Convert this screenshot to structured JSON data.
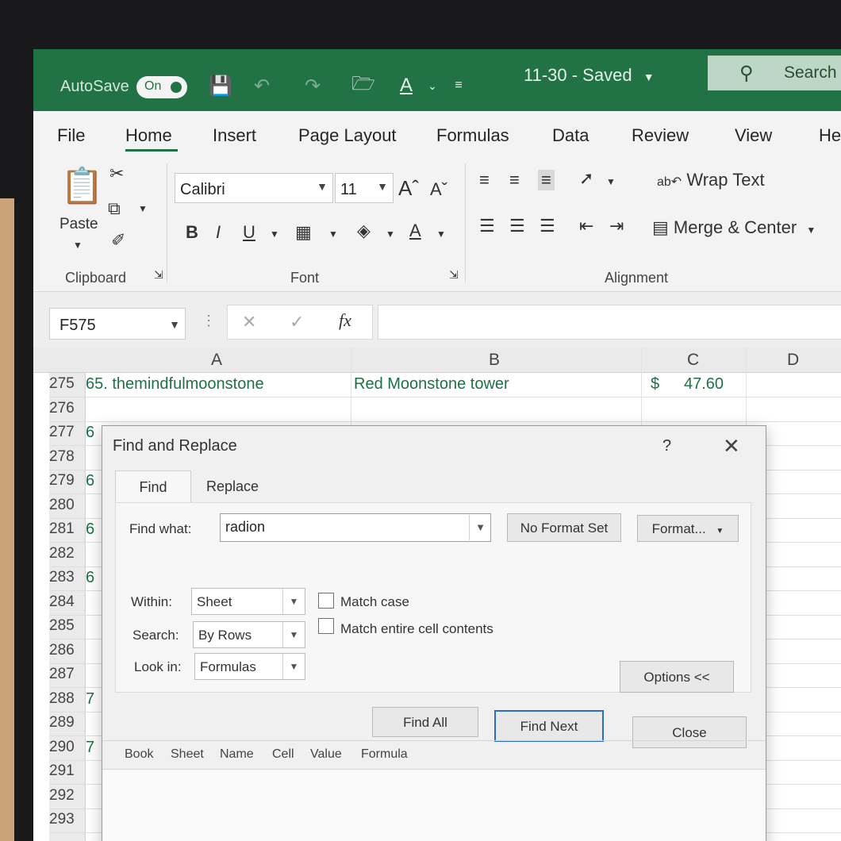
{
  "titlebar": {
    "autosave_label": "AutoSave",
    "autosave_state": "On",
    "doc_title": "11-30 - Saved",
    "search_placeholder": "Search"
  },
  "ribbon_tabs": [
    "File",
    "Home",
    "Insert",
    "Page Layout",
    "Formulas",
    "Data",
    "Review",
    "View",
    "He"
  ],
  "ribbon": {
    "clipboard": {
      "paste_label": "Paste",
      "group_label": "Clipboard"
    },
    "font": {
      "font_name": "Calibri",
      "font_size": "11",
      "group_label": "Font",
      "bold": "B",
      "italic": "I",
      "underline": "U"
    },
    "alignment": {
      "wrap_text": "Wrap Text",
      "merge_center": "Merge & Center",
      "group_label": "Alignment"
    }
  },
  "formula_bar": {
    "name_box": "F575",
    "fx_label": "fx",
    "formula": ""
  },
  "grid": {
    "columns": [
      "A",
      "B",
      "C",
      "D"
    ],
    "rows": [
      {
        "num": "275",
        "a": "65. themindfulmoonstone",
        "b": "Red Moonstone tower",
        "c_currency": "$",
        "c_value": "47.60"
      },
      {
        "num": "276"
      },
      {
        "num": "277",
        "a": "6"
      },
      {
        "num": "278"
      },
      {
        "num": "279",
        "a": "6"
      },
      {
        "num": "280"
      },
      {
        "num": "281",
        "a": "6"
      },
      {
        "num": "282"
      },
      {
        "num": "283",
        "a": "6"
      },
      {
        "num": "284"
      },
      {
        "num": "285"
      },
      {
        "num": "286"
      },
      {
        "num": "287"
      },
      {
        "num": "288",
        "a": "7"
      },
      {
        "num": "289"
      },
      {
        "num": "290",
        "a": "7"
      },
      {
        "num": "291"
      },
      {
        "num": "292"
      },
      {
        "num": "293"
      }
    ]
  },
  "dialog": {
    "title": "Find and Replace",
    "help": "?",
    "tabs": [
      "Find",
      "Replace"
    ],
    "find_what_label": "Find what:",
    "find_what_value": "radion",
    "no_format_label": "No Format Set",
    "format_label": "Format...",
    "within_label": "Within:",
    "within_value": "Sheet",
    "search_label": "Search:",
    "search_value": "By Rows",
    "lookin_label": "Look in:",
    "lookin_value": "Formulas",
    "match_case_label": "Match case",
    "match_entire_label": "Match entire cell contents",
    "options_label": "Options <<",
    "find_all_label": "Find All",
    "find_next_label": "Find Next",
    "close_label": "Close",
    "results_columns": [
      "Book",
      "Sheet",
      "Name",
      "Cell",
      "Value",
      "Formula"
    ]
  }
}
